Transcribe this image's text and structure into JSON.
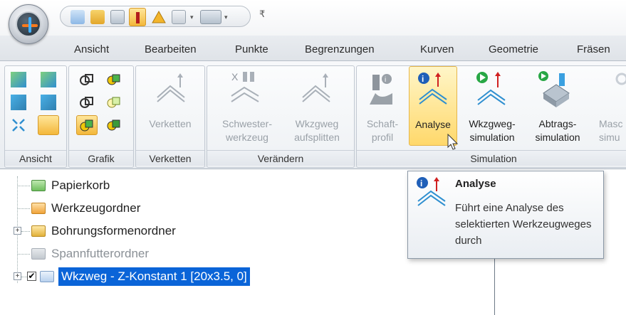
{
  "tabs": [
    "Ansicht",
    "Bearbeiten",
    "Punkte",
    "Begrenzungen",
    "Kurven",
    "Geometrie",
    "Fräsen"
  ],
  "qat_dropdown": "₹",
  "ribbon": {
    "groups": {
      "ansicht": "Ansicht",
      "grafik": "Grafik",
      "verketten": "Verketten",
      "veraendern": "Verändern",
      "simulation": "Simulation"
    },
    "buttons": {
      "verketten": "Verketten",
      "schwesterwerkzeug_1": "Schwester-",
      "schwesterwerkzeug_2": "werkzeug",
      "wkzgweg_aufsplitten_1": "Wkzgweg",
      "wkzgweg_aufsplitten_2": "aufsplitten",
      "schaftprofil_1": "Schaft-",
      "schaftprofil_2": "profil",
      "analyse": "Analyse",
      "wkzgweg_simulation_1": "Wkzgweg-",
      "wkzgweg_simulation_2": "simulation",
      "abtrags_simulation_1": "Abtrags-",
      "abtrags_simulation_2": "simulation",
      "maschinen_1": "Masc",
      "maschinen_2": "simu"
    }
  },
  "tree": {
    "items": [
      {
        "label": "Papierkorb"
      },
      {
        "label": "Werkzeugordner"
      },
      {
        "label": "Bohrungsformenordner"
      },
      {
        "label": "Spannfutterordner"
      },
      {
        "label": "Wkzweg - Z-Konstant 1 [20x3.5, 0]"
      }
    ]
  },
  "tooltip": {
    "title": "Analyse",
    "description": "Führt eine Analyse des selektierten Werkzeugweges durch"
  },
  "colors": {
    "selection": "#0a64d8",
    "hover_highlight": "#ffd86b",
    "folder_green": "#4aa84a",
    "folder_orange": "#e8a12a"
  }
}
